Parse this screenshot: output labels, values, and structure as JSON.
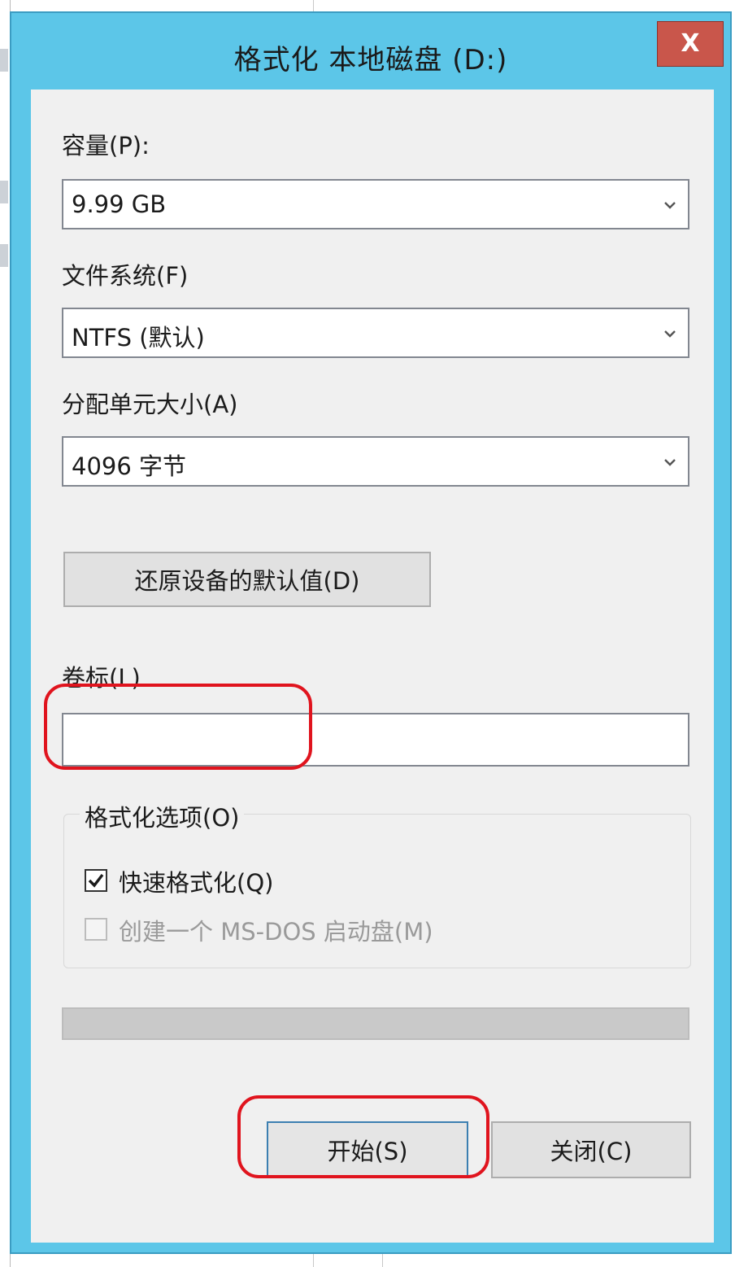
{
  "window": {
    "title": "格式化 本地磁盘 (D:)",
    "close_label": "X"
  },
  "capacity": {
    "label": "容量(P):",
    "value": "9.99 GB"
  },
  "filesystem": {
    "label": "文件系统(F)",
    "value": "NTFS (默认)"
  },
  "allocation": {
    "label": "分配单元大小(A)",
    "value": "4096 字节"
  },
  "restore_defaults_label": "还原设备的默认值(D)",
  "volume_label": {
    "label": "卷标(L)",
    "value": ""
  },
  "format_options": {
    "title": "格式化选项(O)",
    "quick_format": {
      "label": "快速格式化(Q)",
      "checked": true
    },
    "msdos_boot": {
      "label": "创建一个 MS-DOS 启动盘(M)",
      "checked": false,
      "enabled": false
    }
  },
  "progress": {
    "fraction": 0
  },
  "buttons": {
    "start": "开始(S)",
    "close": "关闭(C)"
  },
  "colors": {
    "title_bar": "#5cc6e8",
    "close_button": "#c9564b",
    "annotation": "#e0141e"
  }
}
